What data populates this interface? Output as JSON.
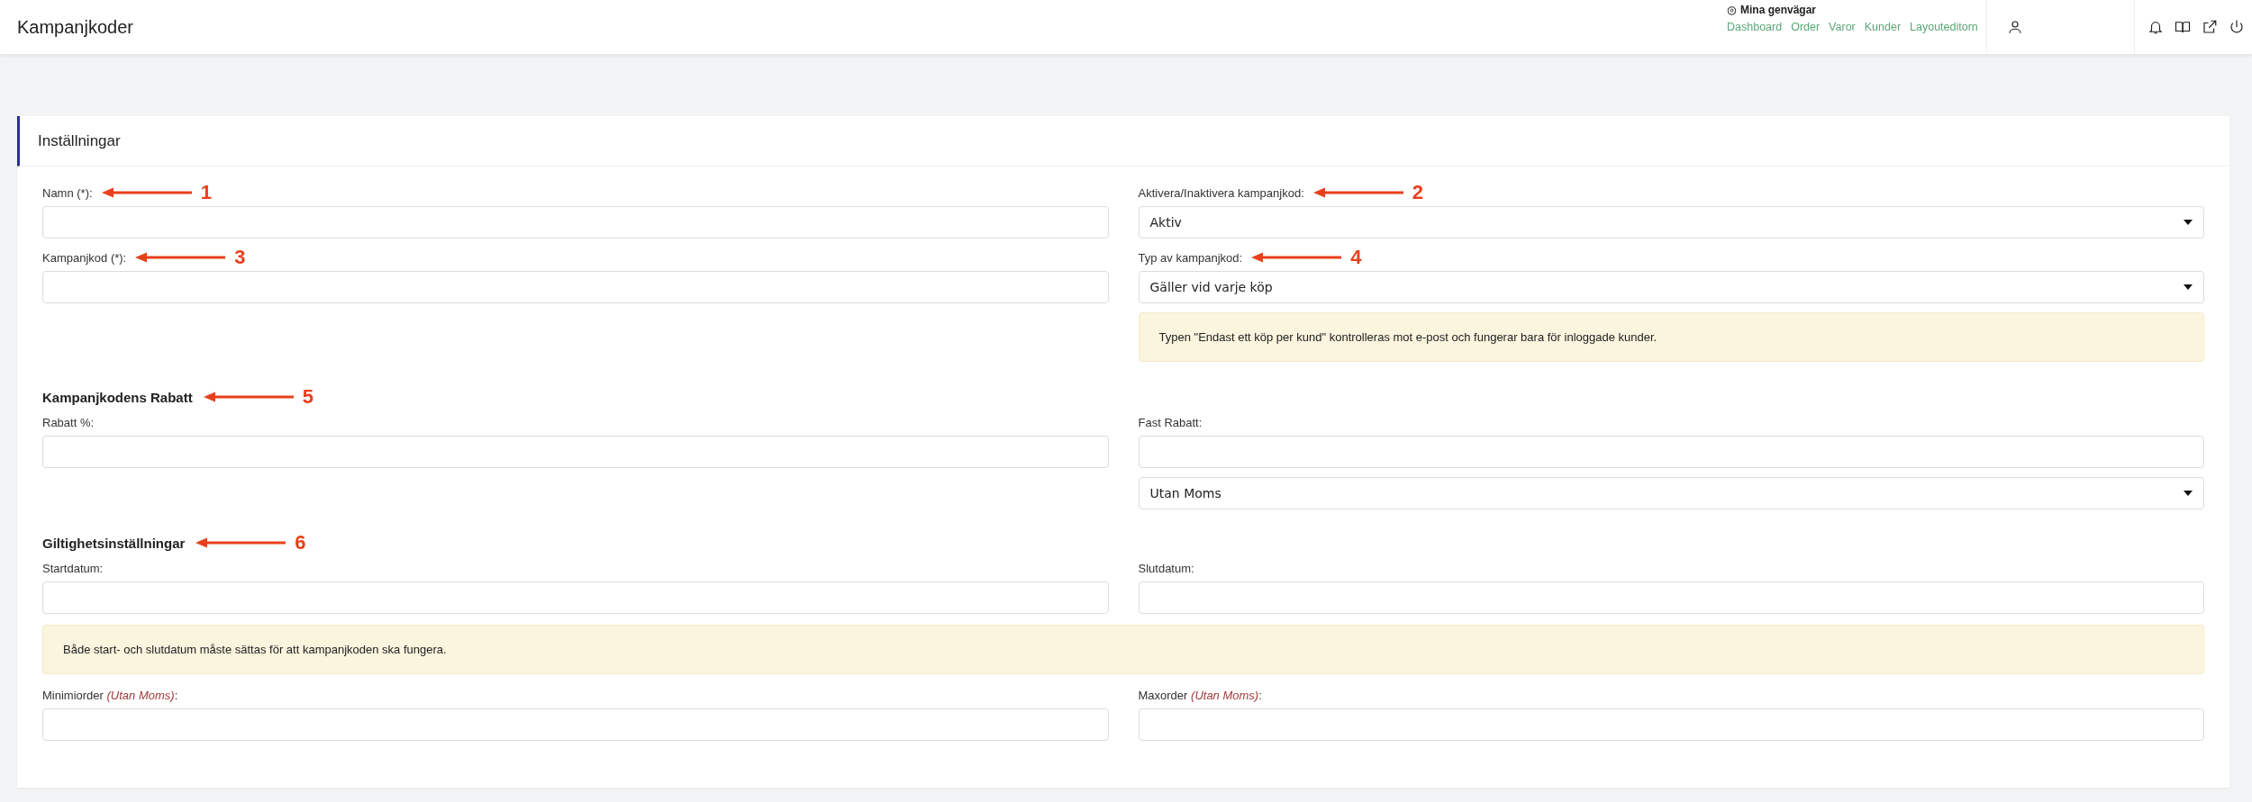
{
  "header": {
    "title": "Kampanjkoder",
    "shortcuts": {
      "title": "Mina genvägar",
      "links": [
        "Dashboard",
        "Order",
        "Varor",
        "Kunder",
        "Layouteditorn"
      ]
    }
  },
  "card": {
    "title": "Inställningar",
    "sections": [
      {
        "rows": [
          {
            "left": [
              {
                "kind": "input",
                "label": "Namn (*):",
                "callout": "1"
              },
              {
                "kind": "input",
                "label": "Kampanjkod (*):",
                "callout": "3"
              }
            ],
            "right": [
              {
                "kind": "select",
                "label": "Aktivera/Inaktivera kampanjkod:",
                "callout": "2",
                "value": "Aktiv"
              },
              {
                "kind": "select",
                "label": "Typ av kampanjkod:",
                "callout": "4",
                "value": "Gäller vid varje köp"
              },
              {
                "kind": "alert",
                "text": "Typen \"Endast ett köp per kund\" kontrolleras mot e-post och fungerar bara för inloggade kunder."
              }
            ]
          }
        ]
      },
      {
        "heading": "Kampanjkodens Rabatt",
        "callout": "5",
        "rows": [
          {
            "left": [
              {
                "kind": "input",
                "label": "Rabatt %:"
              }
            ],
            "right": [
              {
                "kind": "input",
                "label": "Fast Rabatt:"
              },
              {
                "kind": "select",
                "value": "Utan Moms"
              }
            ]
          }
        ]
      },
      {
        "heading": "Giltighetsinställningar",
        "callout": "6",
        "rows": [
          {
            "left": [
              {
                "kind": "input",
                "label": "Startdatum:"
              }
            ],
            "right": [
              {
                "kind": "input",
                "label": "Slutdatum:"
              }
            ]
          },
          {
            "full": [
              {
                "kind": "alert",
                "text": "Både start- och slutdatum måste sättas för att kampanjkoden ska fungera."
              }
            ]
          },
          {
            "left": [
              {
                "kind": "input",
                "label": "Minimiorder",
                "note": "(Utan Moms)",
                "suffix": ":"
              }
            ],
            "right": [
              {
                "kind": "input",
                "label": "Maxorder",
                "note": "(Utan Moms)",
                "suffix": ":"
              }
            ]
          }
        ]
      }
    ]
  }
}
